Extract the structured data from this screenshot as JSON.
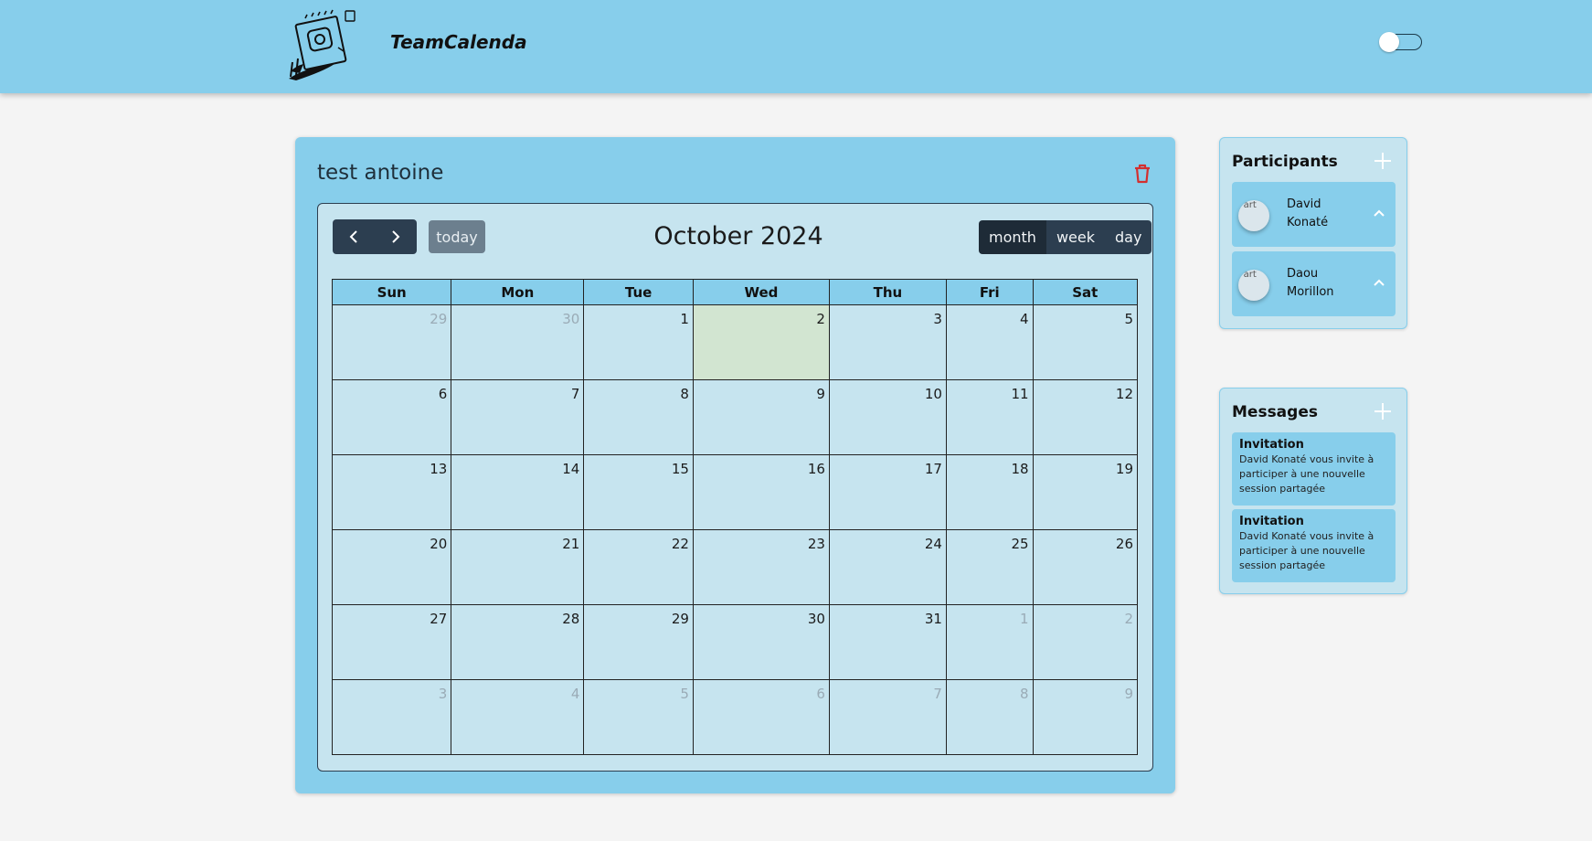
{
  "header": {
    "brand": "TeamCalenda",
    "logo_icon": "calendar-notepad-logo",
    "theme_toggle_on": false
  },
  "calendar": {
    "title": "test antoine",
    "month_title": "October 2024",
    "today_label": "today",
    "views": [
      "month",
      "week",
      "day"
    ],
    "active_view": "month",
    "weekdays": [
      "Sun",
      "Mon",
      "Tue",
      "Wed",
      "Thu",
      "Fri",
      "Sat"
    ],
    "weeks": [
      [
        {
          "d": "29",
          "o": true
        },
        {
          "d": "30",
          "o": true
        },
        {
          "d": "1"
        },
        {
          "d": "2",
          "t": true
        },
        {
          "d": "3"
        },
        {
          "d": "4"
        },
        {
          "d": "5"
        }
      ],
      [
        {
          "d": "6"
        },
        {
          "d": "7"
        },
        {
          "d": "8"
        },
        {
          "d": "9"
        },
        {
          "d": "10"
        },
        {
          "d": "11"
        },
        {
          "d": "12"
        }
      ],
      [
        {
          "d": "13"
        },
        {
          "d": "14"
        },
        {
          "d": "15"
        },
        {
          "d": "16"
        },
        {
          "d": "17"
        },
        {
          "d": "18"
        },
        {
          "d": "19"
        }
      ],
      [
        {
          "d": "20"
        },
        {
          "d": "21"
        },
        {
          "d": "22"
        },
        {
          "d": "23"
        },
        {
          "d": "24"
        },
        {
          "d": "25"
        },
        {
          "d": "26"
        }
      ],
      [
        {
          "d": "27"
        },
        {
          "d": "28"
        },
        {
          "d": "29"
        },
        {
          "d": "30"
        },
        {
          "d": "31"
        },
        {
          "d": "1",
          "o": true
        },
        {
          "d": "2",
          "o": true
        }
      ],
      [
        {
          "d": "3",
          "o": true
        },
        {
          "d": "4",
          "o": true
        },
        {
          "d": "5",
          "o": true
        },
        {
          "d": "6",
          "o": true
        },
        {
          "d": "7",
          "o": true
        },
        {
          "d": "8",
          "o": true
        },
        {
          "d": "9",
          "o": true
        }
      ]
    ]
  },
  "participants": {
    "title": "Participants",
    "items": [
      {
        "first": "David",
        "last": "Konaté",
        "avatar_alt": "Part"
      },
      {
        "first": "Daou",
        "last": "Morillon",
        "avatar_alt": "Part"
      }
    ]
  },
  "messages": {
    "title": "Messages",
    "items": [
      {
        "title": "Invitation",
        "body": "David Konaté vous invite à participer à une nouvelle session partagée"
      },
      {
        "title": "Invitation",
        "body": "David Konaté vous invite à participer à une nouvelle session partagée"
      }
    ]
  },
  "colors": {
    "sky": "#87ceeb",
    "panel": "#c6e4ef",
    "dark_button": "#2c3e50",
    "today_cell": "#d2e5d1",
    "trash": "#d32f2f"
  }
}
